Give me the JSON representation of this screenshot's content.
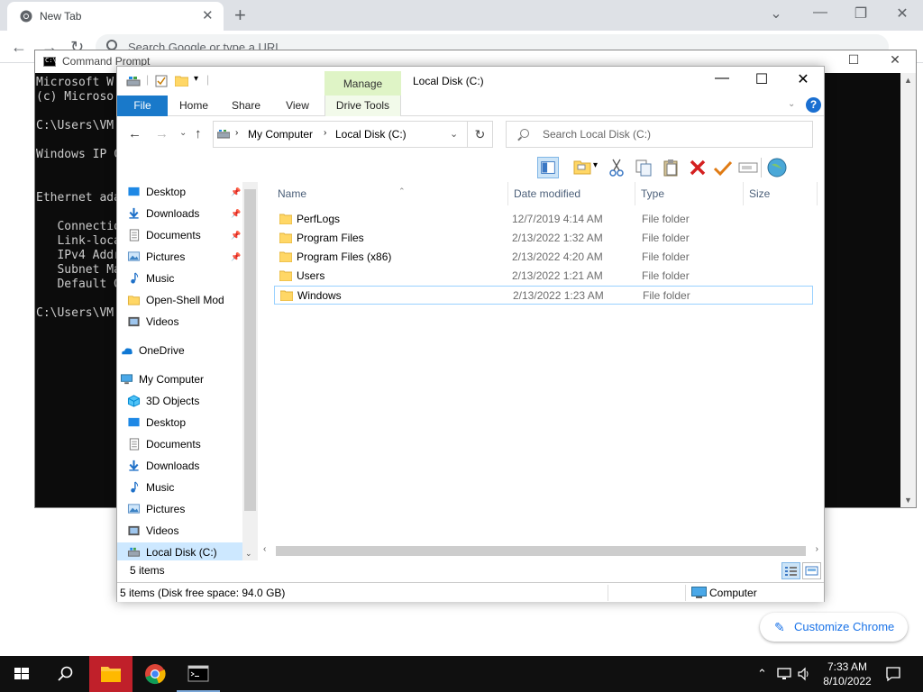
{
  "chrome": {
    "tab_title": "New Tab",
    "omnibox_placeholder": "Search Google or type a URL",
    "customize_label": "Customize Chrome"
  },
  "cmd": {
    "title": "Command Prompt",
    "lines": [
      "Microsoft W",
      "(c) Microso",
      "",
      "C:\\Users\\VM",
      "",
      "Windows IP C",
      "",
      "",
      "Ethernet ada",
      "",
      "   Connectio",
      "   Link-loca",
      "   IPv4 Addr",
      "   Subnet Ma",
      "   Default G",
      "",
      "C:\\Users\\VM"
    ]
  },
  "explorer": {
    "title": "Local Disk (C:)",
    "manage_label": "Manage",
    "ribbon_tabs": [
      "File",
      "Home",
      "Share",
      "View",
      "Drive Tools"
    ],
    "breadcrumb": [
      "My Computer",
      "Local Disk (C:)"
    ],
    "search_placeholder": "Search Local Disk (C:)",
    "columns": [
      "Name",
      "Date modified",
      "Type",
      "Size"
    ],
    "files": [
      {
        "name": "PerfLogs",
        "date": "12/7/2019 4:14 AM",
        "type": "File folder"
      },
      {
        "name": "Program Files",
        "date": "2/13/2022 1:32 AM",
        "type": "File folder"
      },
      {
        "name": "Program Files (x86)",
        "date": "2/13/2022 4:20 AM",
        "type": "File folder"
      },
      {
        "name": "Users",
        "date": "2/13/2022 1:21 AM",
        "type": "File folder"
      },
      {
        "name": "Windows",
        "date": "2/13/2022 1:23 AM",
        "type": "File folder"
      }
    ],
    "nav": {
      "quick_access": [
        "Desktop",
        "Downloads",
        "Documents",
        "Pictures",
        "Music",
        "Open-Shell Mod",
        "Videos"
      ],
      "onedrive": "OneDrive",
      "computer": "My Computer",
      "computer_items": [
        "3D Objects",
        "Desktop",
        "Documents",
        "Downloads",
        "Music",
        "Pictures",
        "Videos",
        "Local Disk (C:)"
      ]
    },
    "items_count": "5 items",
    "status_left": "5 items (Disk free space: 94.0 GB)",
    "status_right": "Computer"
  },
  "taskbar": {
    "time": "7:33 AM",
    "date": "8/10/2022"
  },
  "colors": {
    "file_tab": "#1979ca",
    "manage_tab": "#dff4c6",
    "selection": "#cde8ff",
    "taskbar": "#101010",
    "active_taskbar_item": "#c0202a"
  }
}
